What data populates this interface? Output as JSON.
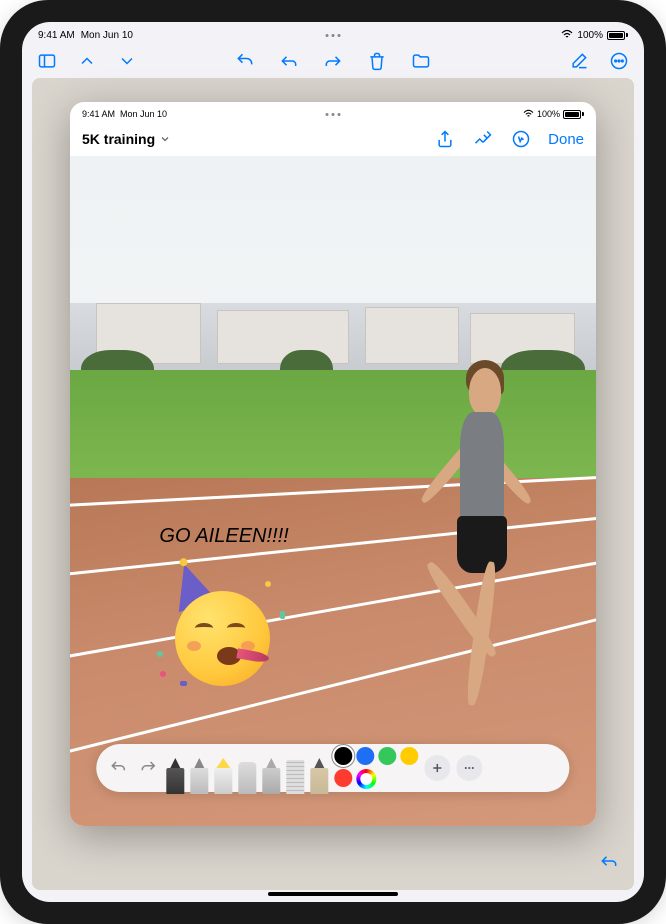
{
  "outer_status": {
    "time": "9:41 AM",
    "date": "Mon Jun 10",
    "battery": "100%"
  },
  "inner_status": {
    "time": "9:41 AM",
    "date": "Mon Jun 10",
    "battery": "100%"
  },
  "note_title": "5K training",
  "toolbar": {
    "done_label": "Done"
  },
  "annotation": {
    "text": "GO AILEEN!!!!",
    "emoji_name": "party-face"
  },
  "markup": {
    "tools": [
      "pen",
      "marker",
      "highlighter",
      "eraser",
      "lasso",
      "ruler",
      "pencil"
    ],
    "colors": [
      {
        "name": "black",
        "hex": "#000000",
        "selected": true
      },
      {
        "name": "blue",
        "hex": "#1e6ff5",
        "selected": false
      },
      {
        "name": "green",
        "hex": "#34c759",
        "selected": false
      },
      {
        "name": "yellow",
        "hex": "#ffcc00",
        "selected": false
      },
      {
        "name": "red",
        "hex": "#ff3b30",
        "selected": false
      }
    ]
  },
  "colors": {
    "accent": "#007aff"
  }
}
